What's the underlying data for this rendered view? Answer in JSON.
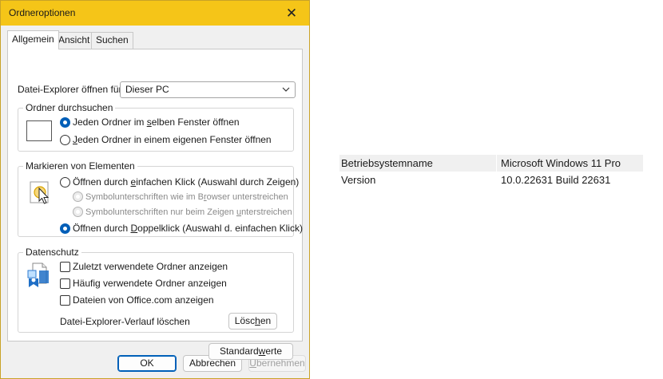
{
  "window": {
    "title": "Ordneroptionen",
    "close_glyph": "✕"
  },
  "tabs": [
    {
      "label": "Allgemein",
      "active": true
    },
    {
      "label": "Ansicht",
      "active": false
    },
    {
      "label": "Suchen",
      "active": false
    }
  ],
  "open_for": {
    "label": "Datei-Explorer öffnen für:",
    "value": "Dieser PC"
  },
  "browse_group": {
    "title": "Ordner durchsuchen",
    "opt1_pre": "Jeden Ordner im ",
    "opt1_u": "s",
    "opt1_post": "elben Fenster öffnen",
    "opt2_pre": "",
    "opt2_u": "J",
    "opt2_post": "eden Ordner in einem eigenen Fenster öffnen",
    "selected": 0
  },
  "click_group": {
    "title": "Markieren von Elementen",
    "single_pre": "Öffnen durch ",
    "single_u": "e",
    "single_post": "infachen Klick (Auswahl durch Zeigen)",
    "sub1_pre": "Symbolunterschriften wie im B",
    "sub1_u": "r",
    "sub1_post": "owser unterstreichen",
    "sub2_pre": "Symbolunterschriften nur beim Zeigen ",
    "sub2_u": "u",
    "sub2_post": "nterstreichen",
    "double_pre": "Öffnen durch ",
    "double_u": "D",
    "double_post": "oppelklick (Auswahl d. einfachen Klick)",
    "selected": "double"
  },
  "privacy_group": {
    "title": "Datenschutz",
    "check1": "Zuletzt verwendete Ordner anzeigen",
    "check2": "Häufig verwendete Ordner anzeigen",
    "check3": "Dateien von Office.com anzeigen",
    "history_label": "Datei-Explorer-Verlauf löschen",
    "clear_pre": "Lösc",
    "clear_u": "h",
    "clear_post": "en"
  },
  "defaults_button": {
    "pre": "Standard",
    "u": "w",
    "post": "erte"
  },
  "footer": {
    "ok": "OK",
    "cancel": "Abbrechen",
    "apply_pre": "",
    "apply_u": "Ü",
    "apply_post": "bernehmen"
  },
  "system_info": {
    "rows": [
      {
        "key": "Betriebsystemname",
        "value": "Microsoft Windows 11 Pro"
      },
      {
        "key": "Version",
        "value": "10.0.22631 Build 22631"
      }
    ]
  },
  "colors": {
    "titlebar": "#f5c518",
    "accent": "#005fb8"
  },
  "icons": [
    "close-icon",
    "chevron-down-icon",
    "folder-window-icon",
    "pointer-click-icon",
    "privacy-document-icon"
  ]
}
